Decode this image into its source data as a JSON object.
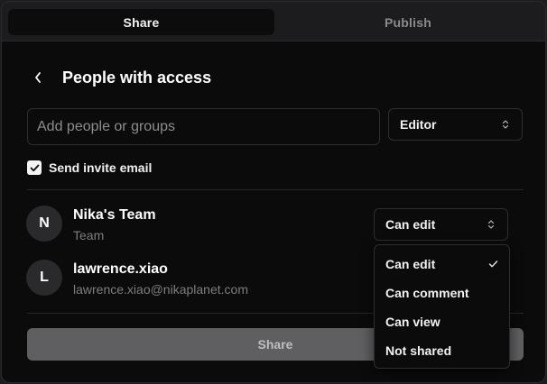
{
  "tabs": [
    {
      "label": "Share",
      "active": true
    },
    {
      "label": "Publish",
      "active": false
    }
  ],
  "header": {
    "title": "People with access"
  },
  "add_people": {
    "placeholder": "Add people or groups",
    "value": ""
  },
  "role_select": {
    "value": "Editor"
  },
  "invite": {
    "label": "Send invite email",
    "checked": true
  },
  "people": [
    {
      "initial": "N",
      "name": "Nika's Team",
      "subtitle": "Team",
      "permission": "Can edit"
    },
    {
      "initial": "L",
      "name": "lawrence.xiao",
      "subtitle": "lawrence.xiao@nikaplanet.com"
    }
  ],
  "permission_menu": {
    "options": [
      "Can edit",
      "Can comment",
      "Can view",
      "Not shared"
    ],
    "selected": "Can edit"
  },
  "share_button": {
    "label": "Share"
  },
  "colors": {
    "background": "#0b0b0c",
    "border": "#2e2e31",
    "share_button": "#5f5f61",
    "muted_text": "#7d7d82"
  },
  "icons": [
    "chevron-left-icon",
    "chevron-up-down-icon",
    "checkmark-icon"
  ]
}
